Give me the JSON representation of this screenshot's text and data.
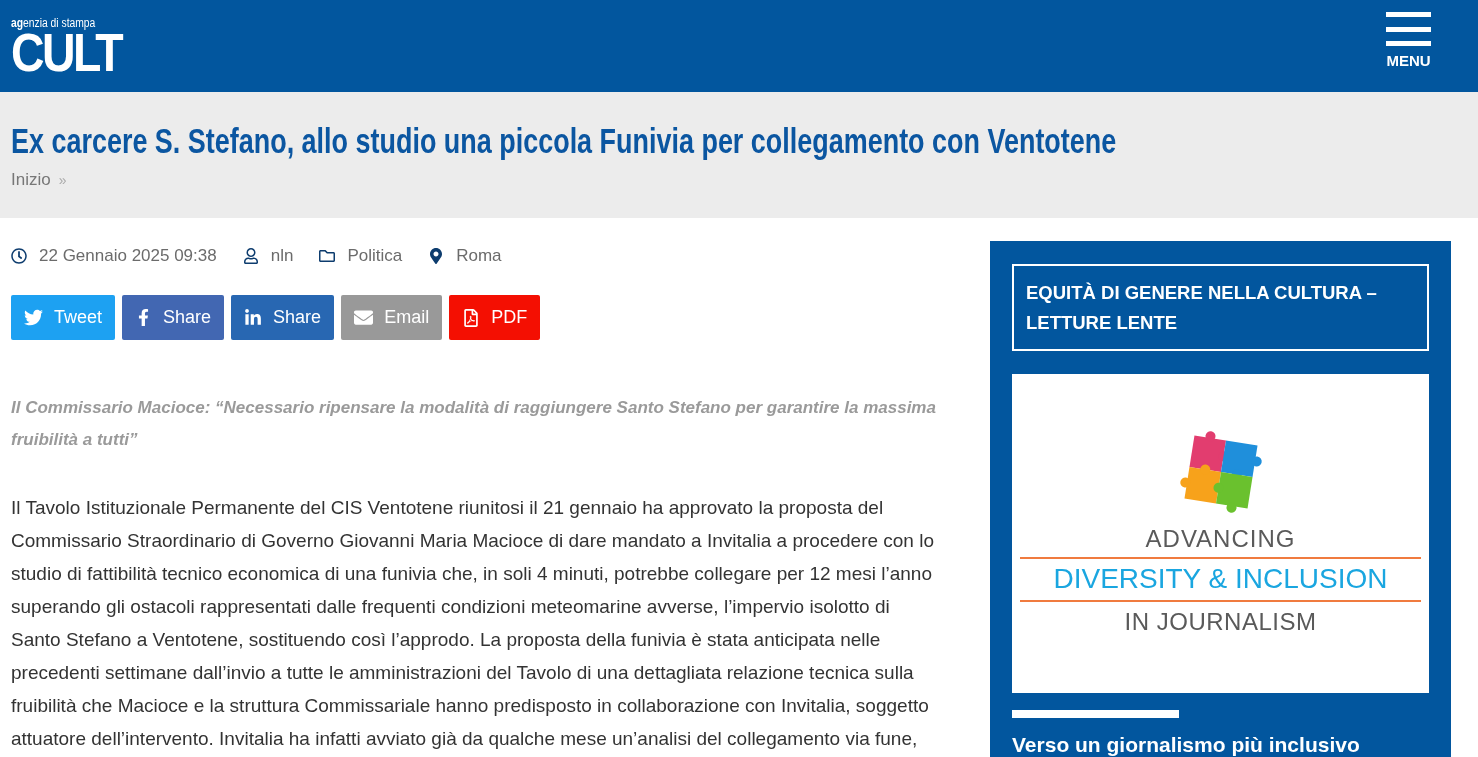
{
  "header": {
    "logo": {
      "tagline": "**ag**enzia di stampa",
      "wordmark": "CULT"
    },
    "menu_button": {
      "label": "MENU"
    }
  },
  "title_band": {
    "title": "Ex carcere S. Stefano, allo studio una piccola Funivia per collegamento con Ventotene",
    "breadcrumb": [
      {
        "label": "Inizio",
        "separator": "»"
      }
    ]
  },
  "article": {
    "meta": [
      {
        "kind": "date",
        "text": "22 Gennaio 2025 09:38"
      },
      {
        "kind": "author",
        "text": "nln"
      },
      {
        "kind": "category",
        "text": "Politica"
      },
      {
        "kind": "location",
        "text": "Roma"
      }
    ],
    "share_buttons": [
      {
        "kind": "twitter",
        "label": "Tweet"
      },
      {
        "kind": "facebook",
        "label": "Share"
      },
      {
        "kind": "linkedin",
        "label": "Share"
      },
      {
        "kind": "email",
        "label": "Email"
      },
      {
        "kind": "pdf",
        "label": "PDF"
      }
    ],
    "subtitle": "Il Commissario Macioce: “Necessario ripensare la modalità di raggiungere Santo Stefano per garantire la massima fruibilità a tutti”",
    "body": "Il Tavolo Istituzionale Permanente del CIS Ventotene riunitosi il 21 gennaio ha approvato la proposta del Commissario Straordinario di Governo Giovanni Maria Macioce di dare mandato a Invitalia a procedere con lo studio di fattibilità tecnico economica di una funivia che, in soli 4 minuti, potrebbe collegare per 12 mesi l’anno superando gli ostacoli rappresentati dalle frequenti condizioni meteomarine avverse, l’impervio isolotto di Santo Stefano a Ventotene, sostituendo così l’approdo. La proposta della funivia è stata anticipata nelle precedenti settimane dall’invio a tutte le amministrazioni del Tavolo di una dettagliata relazione tecnica sulla fruibilità che Macioce e la struttura Commissariale hanno predisposto in collaborazione con Invitalia, soggetto attuatore dell’intervento. Invitalia ha infatti avviato già da qualche mese un’analisi del collegamento via fune,"
  },
  "sidebar": {
    "heading": "EQUITÀ DI GENERE NELLA CULTURA – LETTURE LENTE",
    "banner": {
      "lines": [
        {
          "kind": "top",
          "text": "ADVANCING"
        },
        {
          "kind": "main",
          "text": "DIVERSITY & INCLUSION"
        },
        {
          "kind": "bottom",
          "text": "IN JOURNALISM"
        }
      ]
    },
    "article_title": "Verso un giornalismo più inclusivo"
  }
}
